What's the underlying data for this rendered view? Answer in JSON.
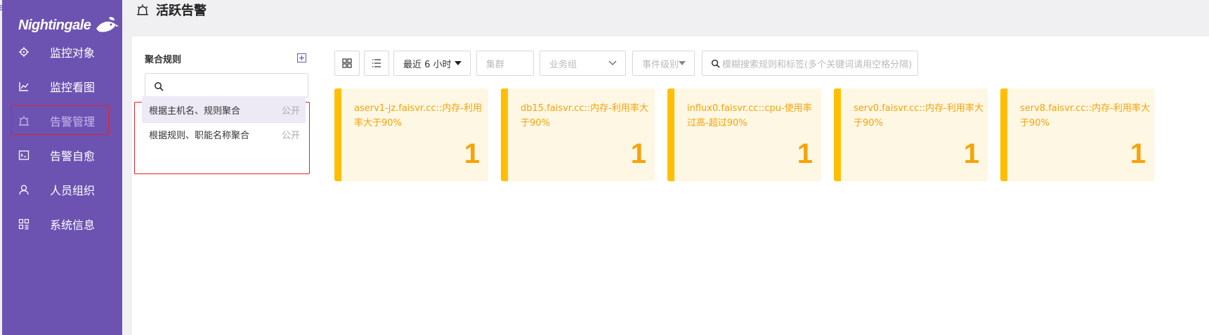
{
  "app": {
    "logo_text": "Nightingale",
    "page_title": "活跃告警"
  },
  "sidebar": {
    "items": [
      {
        "label": "监控对象",
        "icon": "crosshair-icon"
      },
      {
        "label": "监控看图",
        "icon": "line-chart-icon"
      },
      {
        "label": "告警管理",
        "icon": "alarm-icon",
        "active": true
      },
      {
        "label": "告警自愈",
        "icon": "terminal-icon"
      },
      {
        "label": "人员组织",
        "icon": "user-icon"
      },
      {
        "label": "系统信息",
        "icon": "grid-icon"
      }
    ]
  },
  "rules": {
    "title": "聚合规则",
    "search_placeholder": "",
    "items": [
      {
        "name": "根据主机名、规则聚合",
        "tag": "公开",
        "selected": true
      },
      {
        "name": "根据规则、职能名称聚合",
        "tag": "公开",
        "selected": false
      }
    ]
  },
  "toolbar": {
    "time_range": "最近 6 小时",
    "cluster_placeholder": "集群",
    "business_group_placeholder": "业务组",
    "severity_placeholder": "事件级别",
    "search_placeholder": "模糊搜索规则和标签(多个关键词请用空格分隔)"
  },
  "cards": [
    {
      "title": "aserv1-jz.faisvr.cc::内存-利用率大于90%",
      "count": "1"
    },
    {
      "title": "db15.faisvr.cc::内存-利用率大于90%",
      "count": "1"
    },
    {
      "title": "influx0.faisvr.cc::cpu-使用率过高-超过90%",
      "count": "1"
    },
    {
      "title": "serv0.faisvr.cc::内存-利用率大于90%",
      "count": "1"
    },
    {
      "title": "serv8.faisvr.cc::内存-利用率大于90%",
      "count": "1"
    }
  ],
  "colors": {
    "sidebar_bg": "#6c53b1",
    "card_accent": "#ffbf00",
    "card_text": "#f5a30a",
    "highlight_box": "#e0202a"
  }
}
